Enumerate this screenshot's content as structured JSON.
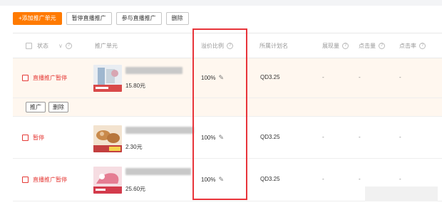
{
  "toolbar": {
    "add_label": "+添加推广单元",
    "pause_label": "暂停直播推广",
    "join_label": "参与直播推广",
    "delete_label": "删除"
  },
  "columns": {
    "status": "状态",
    "unit": "推广单元",
    "ratio": "溢价比例",
    "plan": "所属计划名",
    "impressions": "展现量",
    "clicks": "点击量",
    "ctr": "点击率"
  },
  "rows": [
    {
      "status": "直播推广暂停",
      "price": "15.80元",
      "ratio": "100%",
      "plan": "QD3.25",
      "impressions": "-",
      "clicks": "-",
      "ctr": "-"
    },
    {
      "status": "暂停",
      "price": "2.30元",
      "ratio": "100%",
      "plan": "QD3.25",
      "impressions": "-",
      "clicks": "-",
      "ctr": "-"
    },
    {
      "status": "直播推广暂停",
      "price": "25.60元",
      "ratio": "100%",
      "plan": "QD3.25",
      "impressions": "-",
      "clicks": "-",
      "ctr": "-"
    }
  ],
  "row_actions": {
    "promote_label": "推广",
    "delete_label": "删除"
  },
  "icons": {
    "help": "?",
    "edit": "✎",
    "chevron": "∨"
  },
  "colors": {
    "accent": "#ff7a00",
    "status_red": "#e53935",
    "highlight_box": "#e8343a",
    "row_highlight": "#fff7ef"
  }
}
